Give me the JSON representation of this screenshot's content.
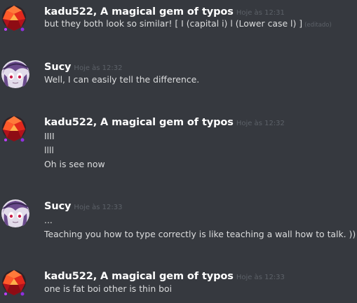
{
  "colors": {
    "background": "#36393f",
    "author": "#ffffff",
    "message_text": "#dcddde",
    "timestamp": "#5c6168"
  },
  "messages": [
    {
      "author": "kadu522, A magical gem of typos",
      "timestamp": "Hoje às 12:31",
      "avatar": "red-gem-avatar",
      "lines": [
        "but they both look so similar! [ I (capital i) l (Lower case l) ]"
      ],
      "edited": "(editado)"
    },
    {
      "author": "Sucy",
      "timestamp": "Hoje às 12:32",
      "avatar": "sucy-avatar",
      "lines": [
        "Well, I can easily tell the difference."
      ]
    },
    {
      "author": "kadu522, A magical gem of typos",
      "timestamp": "Hoje às 12:32",
      "avatar": "red-gem-avatar",
      "lines": [
        "IIII",
        "llll",
        "Oh is see now"
      ]
    },
    {
      "author": "Sucy",
      "timestamp": "Hoje às 12:33",
      "avatar": "sucy-avatar",
      "lines": [
        "...",
        "Teaching you how to type correctly is like teaching a wall how to talk. ))"
      ]
    },
    {
      "author": "kadu522, A magical gem of typos",
      "timestamp": "Hoje às 12:33",
      "avatar": "red-gem-avatar",
      "lines": [
        "one is fat boi other is thin boi"
      ]
    }
  ]
}
